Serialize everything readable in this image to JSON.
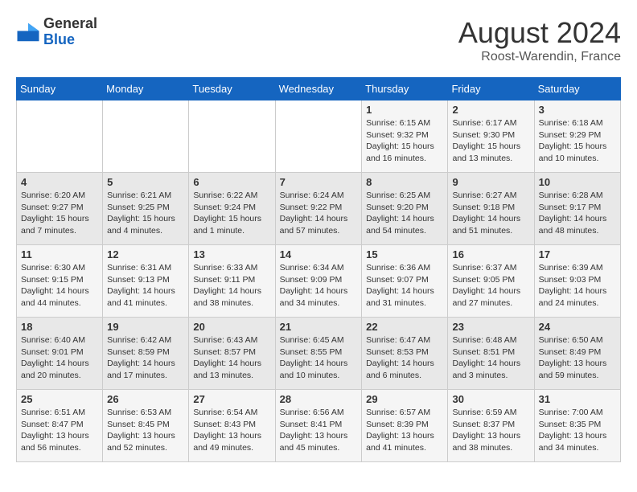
{
  "header": {
    "logo_general": "General",
    "logo_blue": "Blue",
    "month_year": "August 2024",
    "location": "Roost-Warendin, France"
  },
  "days_of_week": [
    "Sunday",
    "Monday",
    "Tuesday",
    "Wednesday",
    "Thursday",
    "Friday",
    "Saturday"
  ],
  "weeks": [
    [
      {
        "day": "",
        "info": ""
      },
      {
        "day": "",
        "info": ""
      },
      {
        "day": "",
        "info": ""
      },
      {
        "day": "",
        "info": ""
      },
      {
        "day": "1",
        "info": "Sunrise: 6:15 AM\nSunset: 9:32 PM\nDaylight: 15 hours and 16 minutes."
      },
      {
        "day": "2",
        "info": "Sunrise: 6:17 AM\nSunset: 9:30 PM\nDaylight: 15 hours and 13 minutes."
      },
      {
        "day": "3",
        "info": "Sunrise: 6:18 AM\nSunset: 9:29 PM\nDaylight: 15 hours and 10 minutes."
      }
    ],
    [
      {
        "day": "4",
        "info": "Sunrise: 6:20 AM\nSunset: 9:27 PM\nDaylight: 15 hours and 7 minutes."
      },
      {
        "day": "5",
        "info": "Sunrise: 6:21 AM\nSunset: 9:25 PM\nDaylight: 15 hours and 4 minutes."
      },
      {
        "day": "6",
        "info": "Sunrise: 6:22 AM\nSunset: 9:24 PM\nDaylight: 15 hours and 1 minute."
      },
      {
        "day": "7",
        "info": "Sunrise: 6:24 AM\nSunset: 9:22 PM\nDaylight: 14 hours and 57 minutes."
      },
      {
        "day": "8",
        "info": "Sunrise: 6:25 AM\nSunset: 9:20 PM\nDaylight: 14 hours and 54 minutes."
      },
      {
        "day": "9",
        "info": "Sunrise: 6:27 AM\nSunset: 9:18 PM\nDaylight: 14 hours and 51 minutes."
      },
      {
        "day": "10",
        "info": "Sunrise: 6:28 AM\nSunset: 9:17 PM\nDaylight: 14 hours and 48 minutes."
      }
    ],
    [
      {
        "day": "11",
        "info": "Sunrise: 6:30 AM\nSunset: 9:15 PM\nDaylight: 14 hours and 44 minutes."
      },
      {
        "day": "12",
        "info": "Sunrise: 6:31 AM\nSunset: 9:13 PM\nDaylight: 14 hours and 41 minutes."
      },
      {
        "day": "13",
        "info": "Sunrise: 6:33 AM\nSunset: 9:11 PM\nDaylight: 14 hours and 38 minutes."
      },
      {
        "day": "14",
        "info": "Sunrise: 6:34 AM\nSunset: 9:09 PM\nDaylight: 14 hours and 34 minutes."
      },
      {
        "day": "15",
        "info": "Sunrise: 6:36 AM\nSunset: 9:07 PM\nDaylight: 14 hours and 31 minutes."
      },
      {
        "day": "16",
        "info": "Sunrise: 6:37 AM\nSunset: 9:05 PM\nDaylight: 14 hours and 27 minutes."
      },
      {
        "day": "17",
        "info": "Sunrise: 6:39 AM\nSunset: 9:03 PM\nDaylight: 14 hours and 24 minutes."
      }
    ],
    [
      {
        "day": "18",
        "info": "Sunrise: 6:40 AM\nSunset: 9:01 PM\nDaylight: 14 hours and 20 minutes."
      },
      {
        "day": "19",
        "info": "Sunrise: 6:42 AM\nSunset: 8:59 PM\nDaylight: 14 hours and 17 minutes."
      },
      {
        "day": "20",
        "info": "Sunrise: 6:43 AM\nSunset: 8:57 PM\nDaylight: 14 hours and 13 minutes."
      },
      {
        "day": "21",
        "info": "Sunrise: 6:45 AM\nSunset: 8:55 PM\nDaylight: 14 hours and 10 minutes."
      },
      {
        "day": "22",
        "info": "Sunrise: 6:47 AM\nSunset: 8:53 PM\nDaylight: 14 hours and 6 minutes."
      },
      {
        "day": "23",
        "info": "Sunrise: 6:48 AM\nSunset: 8:51 PM\nDaylight: 14 hours and 3 minutes."
      },
      {
        "day": "24",
        "info": "Sunrise: 6:50 AM\nSunset: 8:49 PM\nDaylight: 13 hours and 59 minutes."
      }
    ],
    [
      {
        "day": "25",
        "info": "Sunrise: 6:51 AM\nSunset: 8:47 PM\nDaylight: 13 hours and 56 minutes."
      },
      {
        "day": "26",
        "info": "Sunrise: 6:53 AM\nSunset: 8:45 PM\nDaylight: 13 hours and 52 minutes."
      },
      {
        "day": "27",
        "info": "Sunrise: 6:54 AM\nSunset: 8:43 PM\nDaylight: 13 hours and 49 minutes."
      },
      {
        "day": "28",
        "info": "Sunrise: 6:56 AM\nSunset: 8:41 PM\nDaylight: 13 hours and 45 minutes."
      },
      {
        "day": "29",
        "info": "Sunrise: 6:57 AM\nSunset: 8:39 PM\nDaylight: 13 hours and 41 minutes."
      },
      {
        "day": "30",
        "info": "Sunrise: 6:59 AM\nSunset: 8:37 PM\nDaylight: 13 hours and 38 minutes."
      },
      {
        "day": "31",
        "info": "Sunrise: 7:00 AM\nSunset: 8:35 PM\nDaylight: 13 hours and 34 minutes."
      }
    ]
  ]
}
